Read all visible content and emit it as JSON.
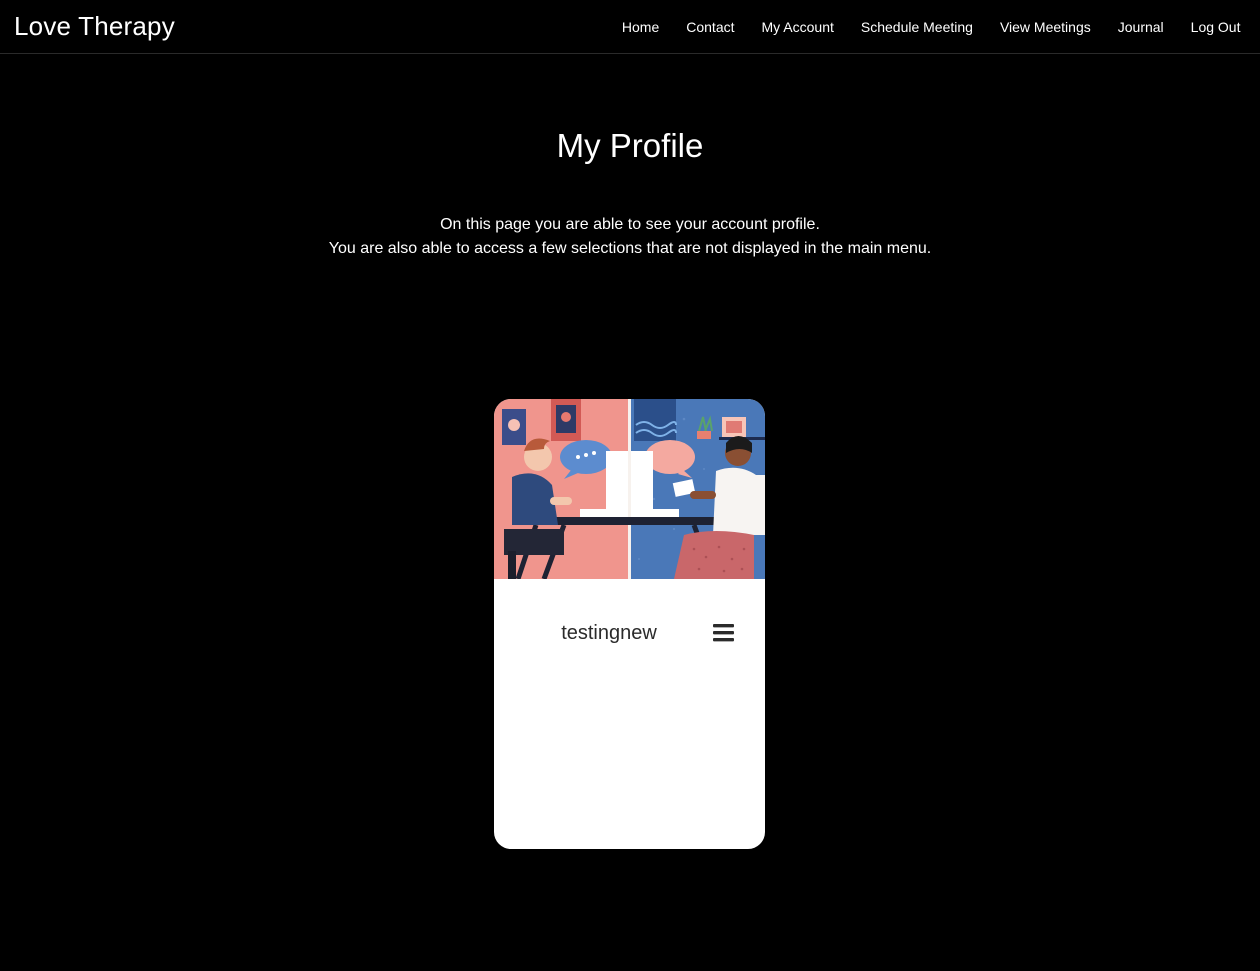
{
  "navbar": {
    "brand": "Love Therapy",
    "links": [
      {
        "label": "Home"
      },
      {
        "label": "Contact"
      },
      {
        "label": "My Account"
      },
      {
        "label": "Schedule Meeting"
      },
      {
        "label": "View Meetings"
      },
      {
        "label": "Journal"
      },
      {
        "label": "Log Out"
      }
    ]
  },
  "main": {
    "title": "My Profile",
    "intro_line_1": "On this page you are able to see your account profile.",
    "intro_line_2": "You are also able to access a few selections that are not displayed in the main menu."
  },
  "profile_card": {
    "username": "testingnew",
    "menu_icon": "hamburger-menu-icon",
    "illustration": "two-people-video-call-illustration"
  },
  "colors": {
    "background": "#000000",
    "text": "#ffffff",
    "card": "#ffffff",
    "illustration_left": "#f0958d",
    "illustration_right": "#4a78b8",
    "speech_bubble_blue": "#5c8ccf",
    "speech_bubble_pink": "#f4a9a0"
  }
}
